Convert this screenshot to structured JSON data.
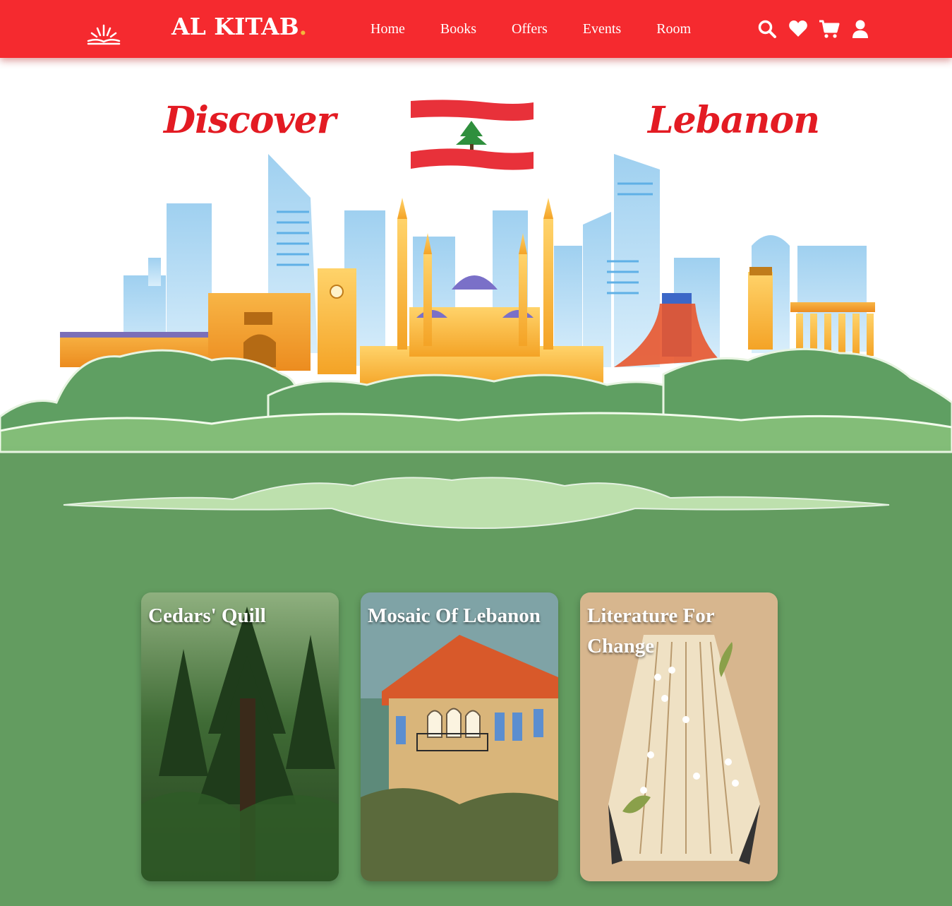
{
  "brand": {
    "name": "AL KITAB",
    "dot": ".",
    "accent": "#f4b63c"
  },
  "nav": {
    "links": [
      "Home",
      "Books",
      "Offers",
      "Events",
      "Room"
    ],
    "icons": [
      "search-icon",
      "heart-icon",
      "cart-icon",
      "user-icon"
    ]
  },
  "hero": {
    "left_word": "Discover",
    "right_word": "Lebanon"
  },
  "colors": {
    "nav_red": "#f52a2f",
    "title_red": "#e31b23",
    "green": "#639c60"
  },
  "cards": [
    {
      "title": "Cedars' Quill"
    },
    {
      "title": "Mosaic Of Lebanon"
    },
    {
      "title": "Literature For Change"
    }
  ]
}
